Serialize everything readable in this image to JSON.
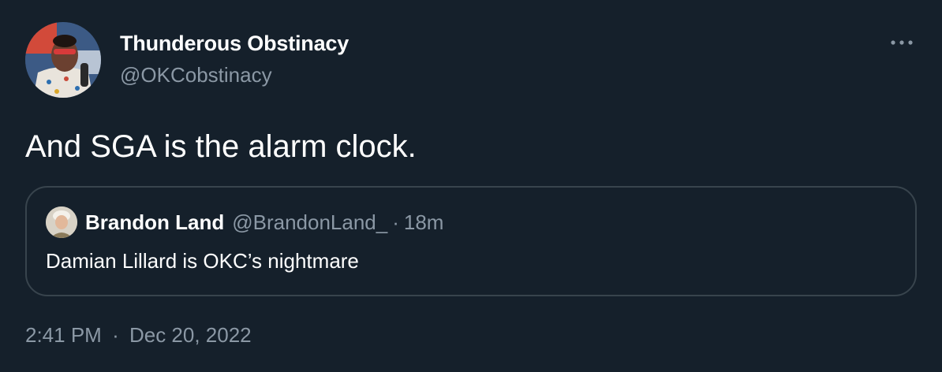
{
  "author": {
    "display_name": "Thunderous Obstinacy",
    "handle": "@OKCobstinacy"
  },
  "more_icon": "more-horizontal-icon",
  "tweet": {
    "text": "And SGA is the alarm clock."
  },
  "quoted_tweet": {
    "display_name": "Brandon Land",
    "handle": "@BrandonLand_",
    "separator": "·",
    "time_ago": "18m",
    "text": "Damian Lillard is OKC’s nightmare"
  },
  "meta": {
    "time": "2:41 PM",
    "separator": "·",
    "date": "Dec 20, 2022"
  },
  "colors": {
    "background": "#15202b",
    "primary_text": "#ffffff",
    "secondary_text": "#8b98a5",
    "border": "#38444d"
  }
}
